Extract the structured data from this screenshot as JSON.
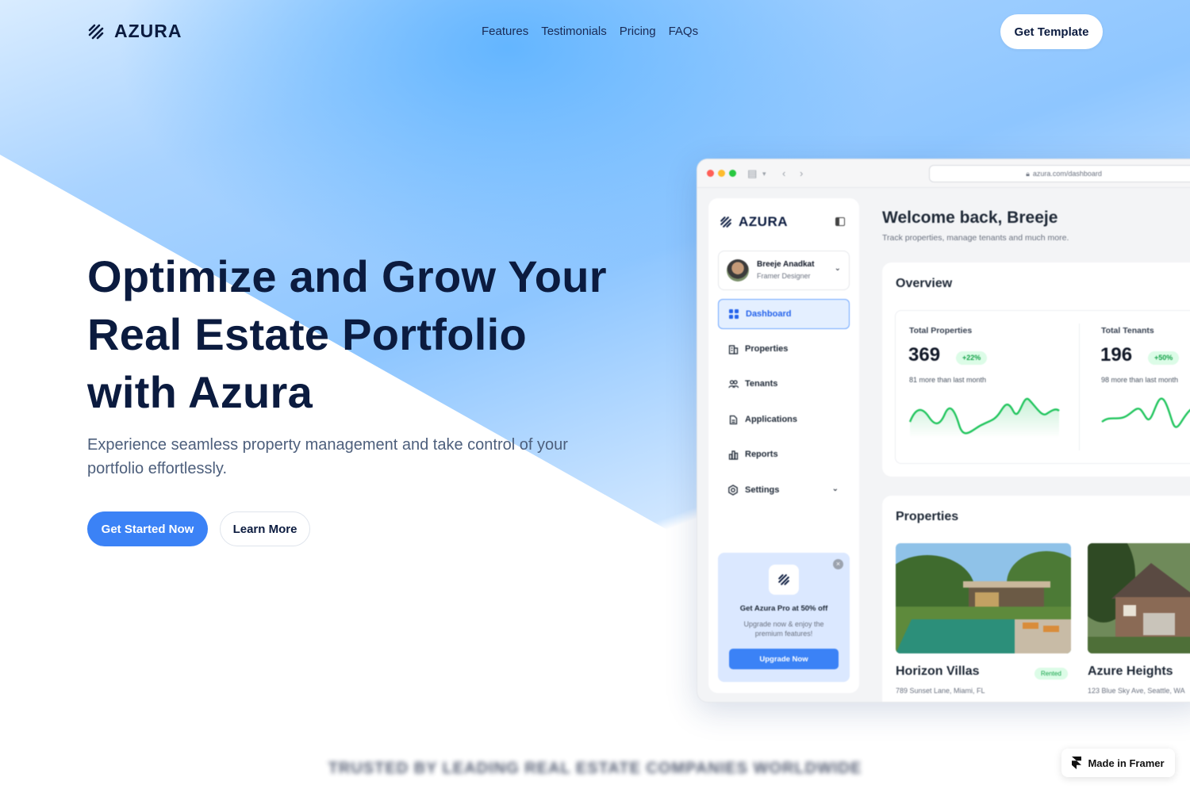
{
  "brand": {
    "name": "AZURA",
    "accent": "#3b82f6",
    "navy": "#0b1b3f"
  },
  "nav": {
    "links": [
      "Features",
      "Testimonials",
      "Pricing",
      "FAQs"
    ],
    "cta": "Get Template"
  },
  "hero": {
    "title_line1": "Optimize and Grow Your",
    "title_line2": "Real Estate Portfolio",
    "title_line3": "with Azura",
    "subtitle_line1": "Experience seamless property management and take control of your",
    "subtitle_line2": "portfolio effortlessly.",
    "primary_button": "Get Started Now",
    "secondary_button": "Learn More"
  },
  "app": {
    "url": "azura.com/dashboard",
    "sidebar": {
      "logo": "AZURA",
      "user": {
        "name": "Breeje Anadkat",
        "role": "Framer Designer"
      },
      "items": [
        {
          "label": "Dashboard",
          "icon": "grid-icon",
          "active": true
        },
        {
          "label": "Properties",
          "icon": "building-icon"
        },
        {
          "label": "Tenants",
          "icon": "users-icon"
        },
        {
          "label": "Applications",
          "icon": "document-icon"
        },
        {
          "label": "Reports",
          "icon": "bar-chart-icon"
        },
        {
          "label": "Settings",
          "icon": "gear-icon"
        }
      ],
      "promo": {
        "title": "Get Azura Pro at 50% off",
        "text_line1": "Upgrade now & enjoy the",
        "text_line2": "premium features!",
        "button": "Upgrade Now"
      }
    },
    "welcome": {
      "title": "Welcome back, Breeje",
      "subtitle": "Track properties, manage tenants and much more."
    },
    "overview": {
      "title": "Overview",
      "stats": [
        {
          "label": "Total Properties",
          "value": "369",
          "badge": "+22%",
          "note": "81 more than last month"
        },
        {
          "label": "Total Tenants",
          "value": "196",
          "badge": "+50%",
          "note": "98 more than last month"
        }
      ]
    },
    "properties": {
      "title": "Properties",
      "items": [
        {
          "name": "Horizon Villas",
          "address": "789 Sunset Lane, Miami, FL",
          "status": "Rented"
        },
        {
          "name": "Azure Heights",
          "address": "123 Blue Sky Ave, Seattle, WA",
          "status": ""
        }
      ]
    }
  },
  "trusted": "TRUSTED BY LEADING REAL ESTATE COMPANIES WORLDWIDE",
  "framer_badge": "Made in Framer"
}
